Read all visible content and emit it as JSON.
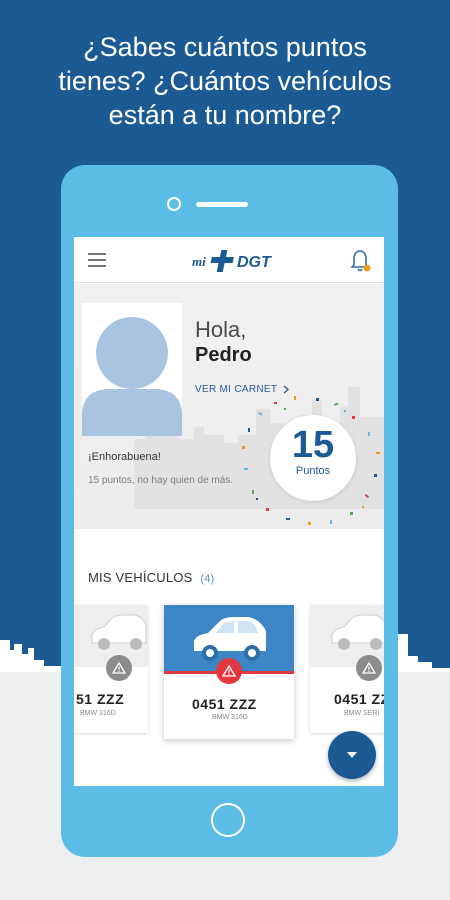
{
  "promo": {
    "title_line1": "¿Sabes cuántos puntos",
    "title_line2": "tienes? ¿Cuántos vehículos",
    "title_line3": "están a tu nombre?"
  },
  "app": {
    "logo_prefix": "mi",
    "logo_text": "DGT",
    "colors": {
      "primary": "#1c5a93",
      "accent": "#5bbce6",
      "alert": "#e3383f",
      "notification": "#f29a1b"
    },
    "icons": [
      "menu-icon",
      "bell-icon",
      "chevron-right-icon",
      "warning-icon",
      "chevron-down-icon"
    ]
  },
  "profile": {
    "greeting": "Hola,",
    "name": "Pedro",
    "carnet_link": "VER MI CARNET",
    "congrats_title": "¡Enhorabuena!",
    "congrats_text": "15 puntos, no hay quien de más.",
    "points_value": "15",
    "points_label": "Puntos"
  },
  "vehicles": {
    "section_title": "MIS VEHÍCULOS",
    "count": "(4)",
    "items": [
      {
        "plate": "51 ZZZ",
        "model": "BMW 316D",
        "alert": true
      },
      {
        "plate": "0451 ZZZ",
        "model": "BMW 316D",
        "alert": true
      },
      {
        "plate": "0451 ZZ",
        "model": "BMW SERI",
        "alert": true
      }
    ]
  }
}
